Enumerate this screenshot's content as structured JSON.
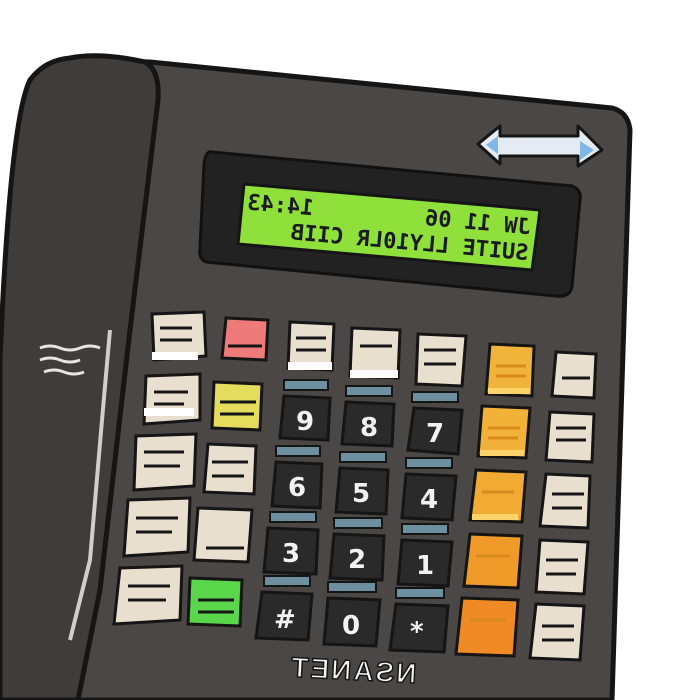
{
  "phone": {
    "brand": "NSANET",
    "display": {
      "line1_left": "JW 11 06",
      "line1_right": "14:43",
      "line2": "SUITE LLY10LR CIIB",
      "color": "#8fe03a"
    },
    "keypad": [
      {
        "label": "9"
      },
      {
        "label": "8"
      },
      {
        "label": "7"
      },
      {
        "label": "6"
      },
      {
        "label": "5"
      },
      {
        "label": "4"
      },
      {
        "label": "3"
      },
      {
        "label": "2"
      },
      {
        "label": "1"
      },
      {
        "label": "#"
      },
      {
        "label": "0"
      },
      {
        "label": "*"
      }
    ],
    "colors": {
      "body": "#4a4744",
      "handset": "#3f3c3a",
      "key": "#2a2a2a",
      "key_accent": "#6e8fa0",
      "button_cream": "#e8dfcf",
      "button_red": "#ef7a7a",
      "button_yellow": "#e3dc5c",
      "button_green": "#59d64a",
      "button_orange": "#f0a02a"
    },
    "icons": {
      "nav_arrow": "double-arrow-icon"
    }
  }
}
